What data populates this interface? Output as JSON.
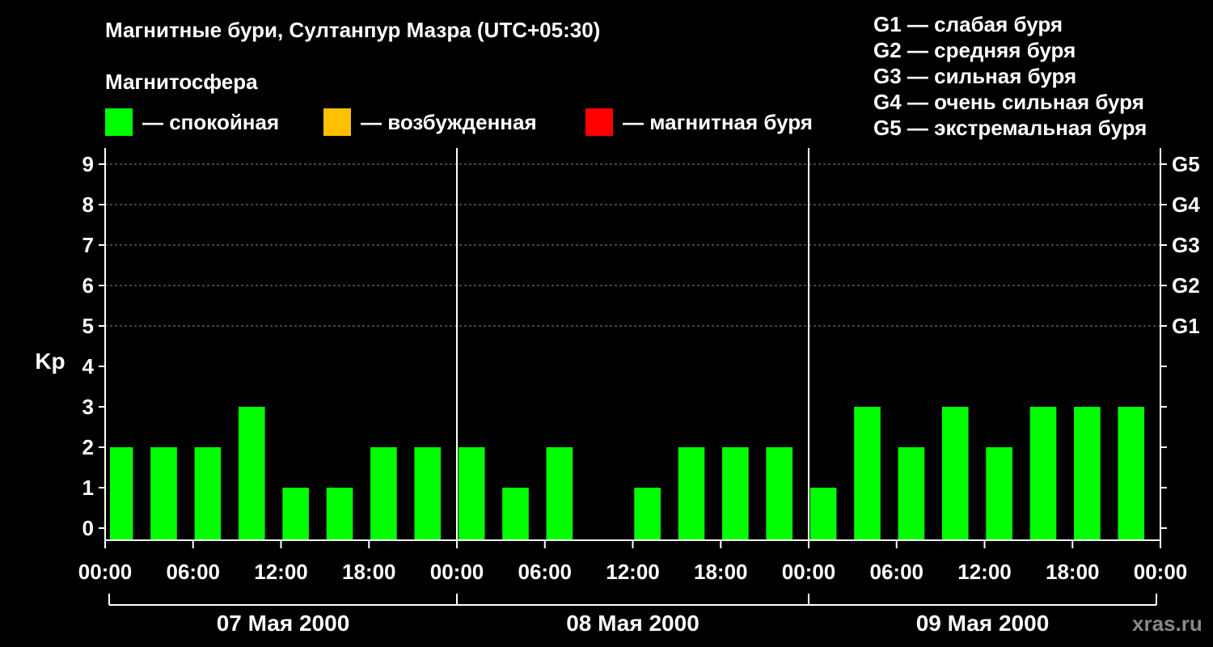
{
  "header": {
    "title": "Магнитные бури, Султанпур Мазра (UTC+05:30)",
    "subtitle": "Магнитосфера"
  },
  "legend": [
    {
      "label": "— спокойная",
      "color": "#00ff00"
    },
    {
      "label": "— возбужденная",
      "color": "#ffc000"
    },
    {
      "label": "— магнитная буря",
      "color": "#ff0000"
    }
  ],
  "storm_levels": [
    "G1 — слабая буря",
    "G2 — средняя буря",
    "G3 — сильная буря",
    "G4 — очень сильная буря",
    "G5 — экстремальная буря"
  ],
  "watermark": "xras.ru",
  "chart_data": {
    "type": "bar",
    "ylabel": "Kp",
    "ylim": [
      -0.3,
      9.4
    ],
    "yticks": [
      0,
      1,
      2,
      3,
      4,
      5,
      6,
      7,
      8,
      9
    ],
    "right_ticks": [
      {
        "value": 5,
        "label": "G1"
      },
      {
        "value": 6,
        "label": "G2"
      },
      {
        "value": 7,
        "label": "G3"
      },
      {
        "value": 8,
        "label": "G4"
      },
      {
        "value": 9,
        "label": "G5"
      }
    ],
    "xlim_hours": [
      -1,
      71
    ],
    "x_tick_hours": [
      0,
      6,
      12,
      18,
      24,
      30,
      36,
      42,
      48,
      54,
      60,
      66,
      72
    ],
    "x_tick_labels": [
      "00:00",
      "06:00",
      "12:00",
      "18:00",
      "00:00",
      "06:00",
      "12:00",
      "18:00",
      "00:00",
      "06:00",
      "12:00",
      "18:00",
      "00:00"
    ],
    "day_boundaries": [
      23,
      47
    ],
    "days": [
      "07 Мая 2000",
      "08 Мая 2000",
      "09 Мая 2000"
    ],
    "bar_hours": [
      0,
      3,
      6,
      9,
      12,
      15,
      18,
      21,
      24,
      27,
      30,
      33,
      36,
      39,
      42,
      45,
      48,
      51,
      54,
      57,
      60,
      63,
      66,
      69
    ],
    "values": [
      2,
      2,
      2,
      3,
      1,
      1,
      2,
      2,
      2,
      1,
      2,
      0,
      1,
      2,
      2,
      2,
      1,
      3,
      2,
      3,
      2,
      3,
      3,
      3
    ],
    "bar_color": "#00ff00",
    "grid": true
  }
}
